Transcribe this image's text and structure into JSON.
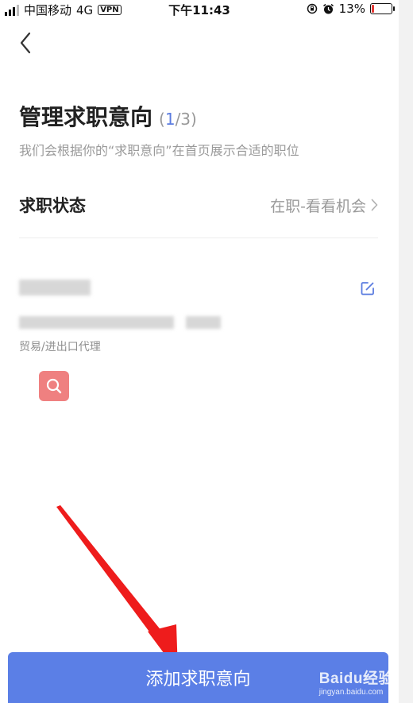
{
  "status_bar": {
    "carrier": "中国移动",
    "network": "4G",
    "vpn": "VPN",
    "time": "下午11:43",
    "battery": "13%",
    "battery_level": 0.13,
    "battery_color": "#e53935"
  },
  "header": {
    "back_icon": "chevron-left-icon",
    "title": "管理求职意向",
    "count_open": "(",
    "count_current": "1",
    "count_rest": "/3)",
    "subtitle": "我们会根据你的“求职意向”在首页展示合适的职位"
  },
  "job_status": {
    "label": "求职状态",
    "value": "在职-看看机会"
  },
  "intention_card": {
    "industry": "贸易/进出口代理",
    "edit_icon": "edit-icon",
    "tag_icon": "search-icon",
    "tag_color": "#ef8080"
  },
  "footer": {
    "add_button_label": "添加求职意向",
    "button_color": "#5b7fe6"
  },
  "watermark": {
    "brand": "Baidu经验",
    "site": "jingyan.baidu.com"
  },
  "accent_color": "#5b7ce0"
}
